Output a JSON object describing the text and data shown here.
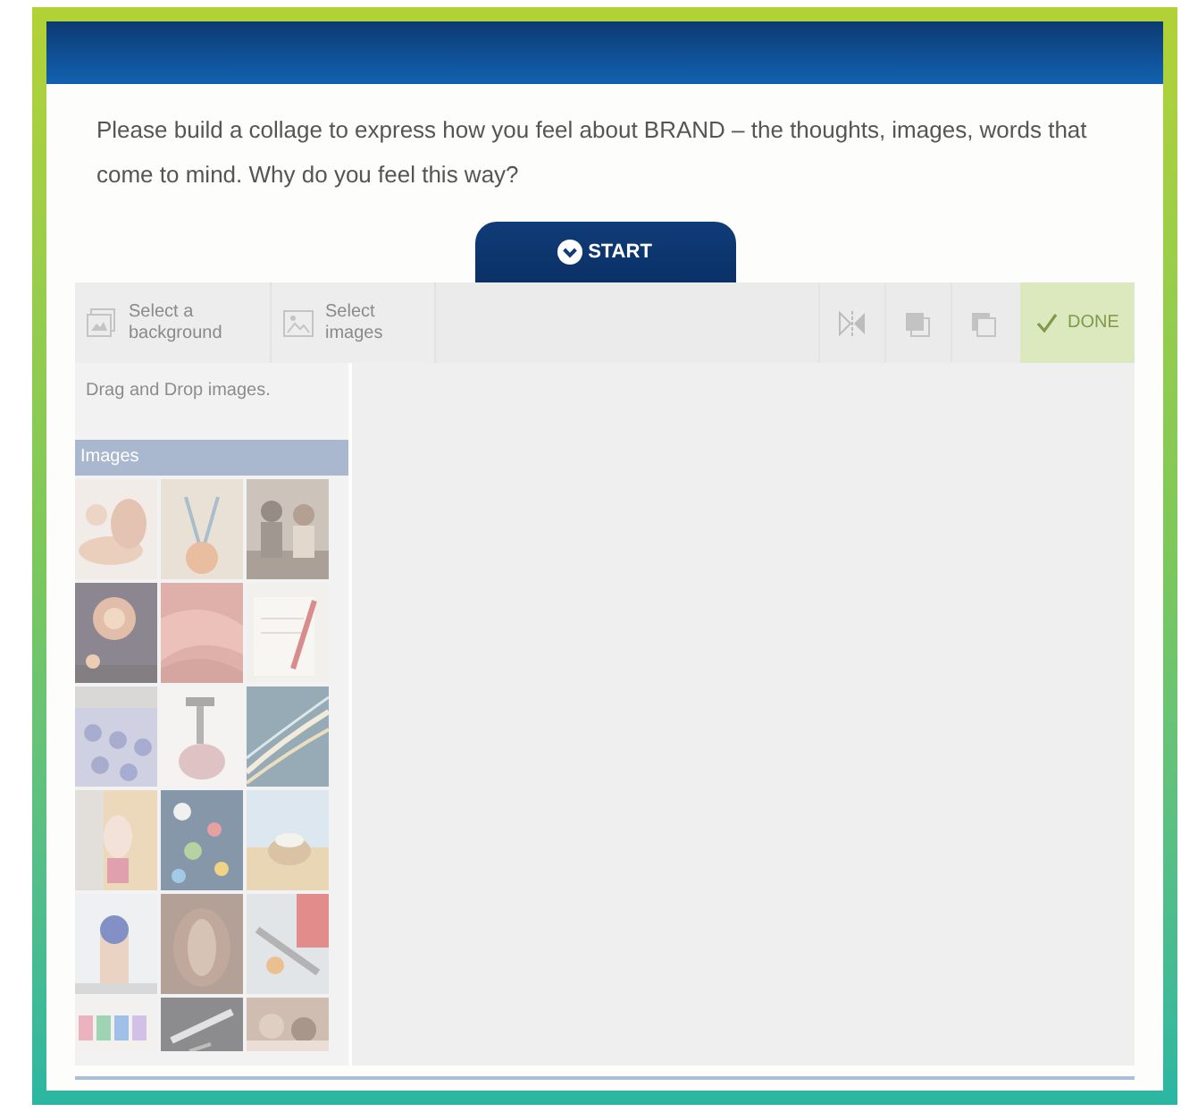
{
  "prompt": "Please build a collage to express how you feel about BRAND – the thoughts, images, words that come to mind. Why do you feel this way?",
  "start_button": {
    "label": "START"
  },
  "toolbar": {
    "disabled": true,
    "sources": [
      {
        "kind": "background",
        "label": "Select a background"
      },
      {
        "kind": "images",
        "label": "Select images"
      }
    ],
    "tools": [
      {
        "kind": "flip"
      },
      {
        "kind": "bring-front"
      },
      {
        "kind": "send-back"
      }
    ],
    "done_button": {
      "label": "DONE"
    }
  },
  "image_panel": {
    "hint": "Drag and Drop images.",
    "title": "Images"
  }
}
